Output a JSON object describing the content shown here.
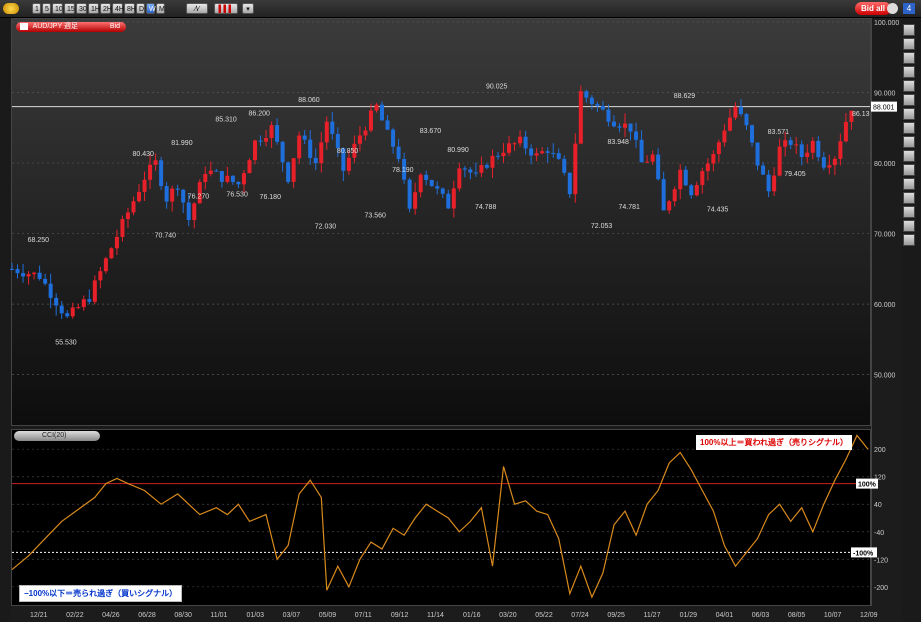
{
  "toolbar": {
    "timeframes": [
      "1",
      "5",
      "10",
      "15",
      "30",
      "1H",
      "2H",
      "4H",
      "8H",
      "D",
      "W",
      "M"
    ],
    "active_timeframe": "W",
    "bid_all_label": "Bid all"
  },
  "symbol": {
    "label": "AUD/JPY 週足",
    "side": "Bid"
  },
  "indicator": {
    "label": "CCI(20)"
  },
  "notes": {
    "overbought": "100%以上＝買われ過ぎ（売りシグナル）",
    "oversold": "−100%以下＝売られ過ぎ（買いシグナル）"
  },
  "cci_levels": {
    "plus": "100%",
    "minus": "-100%"
  },
  "colors": {
    "up": "#e8202a",
    "down": "#1e6fdc",
    "cci": "#d98a1c",
    "level100": "#cc2222",
    "levelm100": "#ffffff"
  },
  "chart_data": [
    {
      "type": "candlestick",
      "series": "AUD/JPY weekly (Bid)",
      "ylim": [
        43,
        100
      ],
      "yticks": [
        50,
        60,
        70,
        80,
        90,
        100
      ],
      "ytick_labels": [
        "50.000",
        "60.000",
        "70.000",
        "80.000",
        "90.000",
        "100.000"
      ],
      "current_price": 88.001,
      "current_price_label": "88.001",
      "last_visible_label": "86.13",
      "x_labels": [
        "12/21",
        "02/22",
        "04/26",
        "06/28",
        "08/30",
        "11/01",
        "01/03",
        "03/07",
        "05/09",
        "07/11",
        "09/12",
        "11/14",
        "01/16",
        "03/20",
        "05/22",
        "07/24",
        "09/25",
        "11/27",
        "01/29",
        "04/01",
        "06/03",
        "08/05",
        "10/07",
        "12/09"
      ],
      "price_path": [
        [
          0,
          65
        ],
        [
          5,
          64
        ],
        [
          10,
          58
        ],
        [
          14,
          61
        ],
        [
          18,
          68
        ],
        [
          21,
          73
        ],
        [
          24,
          78
        ],
        [
          26,
          80
        ],
        [
          28,
          75
        ],
        [
          30,
          77
        ],
        [
          32,
          72
        ],
        [
          35,
          79
        ],
        [
          38,
          78
        ],
        [
          41,
          77
        ],
        [
          44,
          83
        ],
        [
          47,
          85
        ],
        [
          50,
          78
        ],
        [
          52,
          84
        ],
        [
          55,
          80
        ],
        [
          57,
          86
        ],
        [
          60,
          79
        ],
        [
          63,
          84
        ],
        [
          66,
          88
        ],
        [
          68,
          84
        ],
        [
          70,
          81
        ],
        [
          72,
          73
        ],
        [
          74,
          79
        ],
        [
          76,
          77
        ],
        [
          79,
          74
        ],
        [
          81,
          80
        ],
        [
          84,
          78
        ],
        [
          86,
          80
        ],
        [
          89,
          82
        ],
        [
          92,
          83
        ],
        [
          95,
          81
        ],
        [
          97,
          82
        ],
        [
          99,
          80
        ],
        [
          101,
          76
        ],
        [
          103,
          90
        ],
        [
          106,
          88
        ],
        [
          109,
          86
        ],
        [
          112,
          85
        ],
        [
          114,
          80
        ],
        [
          116,
          81
        ],
        [
          118,
          73
        ],
        [
          121,
          79
        ],
        [
          123,
          76
        ],
        [
          125,
          79
        ],
        [
          127,
          81
        ],
        [
          129,
          85
        ],
        [
          131,
          88
        ],
        [
          133,
          85
        ],
        [
          135,
          80
        ],
        [
          137,
          76
        ],
        [
          139,
          82
        ],
        [
          141,
          83
        ],
        [
          143,
          81
        ],
        [
          145,
          83
        ],
        [
          147,
          80
        ],
        [
          149,
          81
        ],
        [
          151,
          86
        ],
        [
          152,
          88
        ]
      ],
      "annotations": [
        {
          "x": 5,
          "y": 68.25,
          "label": "68.250"
        },
        {
          "x": 10,
          "y": 55.53,
          "label": "55.530"
        },
        {
          "x": 24,
          "y": 80.43,
          "label": "80.430"
        },
        {
          "x": 28,
          "y": 70.74,
          "label": "70.740"
        },
        {
          "x": 31,
          "y": 81.99,
          "label": "81.990"
        },
        {
          "x": 34,
          "y": 76.27,
          "label": "76.270"
        },
        {
          "x": 39,
          "y": 85.31,
          "label": "85.310"
        },
        {
          "x": 41,
          "y": 76.53,
          "label": "76.530"
        },
        {
          "x": 45,
          "y": 86.2,
          "label": "86.200"
        },
        {
          "x": 47,
          "y": 76.18,
          "label": "76.180"
        },
        {
          "x": 54,
          "y": 88.06,
          "label": "88.060"
        },
        {
          "x": 57,
          "y": 72.03,
          "label": "72.030"
        },
        {
          "x": 61,
          "y": 80.85,
          "label": "80.850"
        },
        {
          "x": 66,
          "y": 73.56,
          "label": "73.560"
        },
        {
          "x": 71,
          "y": 78.19,
          "label": "78.190"
        },
        {
          "x": 76,
          "y": 83.67,
          "label": "83.670"
        },
        {
          "x": 81,
          "y": 80.99,
          "label": "80.990"
        },
        {
          "x": 86,
          "y": 74.788,
          "label": "74.788"
        },
        {
          "x": 88,
          "y": 90.025,
          "label": "90.025"
        },
        {
          "x": 107,
          "y": 72.053,
          "label": "72.053"
        },
        {
          "x": 110,
          "y": 83.948,
          "label": "83.948"
        },
        {
          "x": 112,
          "y": 74.781,
          "label": "74.781"
        },
        {
          "x": 122,
          "y": 88.629,
          "label": "88.629"
        },
        {
          "x": 128,
          "y": 74.435,
          "label": "74.435"
        },
        {
          "x": 139,
          "y": 83.571,
          "label": "83.571"
        },
        {
          "x": 142,
          "y": 79.405,
          "label": "79.405"
        }
      ]
    },
    {
      "type": "line",
      "series": "CCI(20)",
      "ylim": [
        -250,
        250
      ],
      "yticks": [
        200,
        120,
        40,
        -40,
        -120,
        -200
      ],
      "levels": [
        100,
        -100
      ],
      "points": [
        [
          0,
          -150
        ],
        [
          3,
          -110
        ],
        [
          6,
          -60
        ],
        [
          9,
          -10
        ],
        [
          12,
          25
        ],
        [
          15,
          60
        ],
        [
          17,
          100
        ],
        [
          19,
          115
        ],
        [
          21,
          100
        ],
        [
          24,
          80
        ],
        [
          27,
          40
        ],
        [
          30,
          70
        ],
        [
          32,
          40
        ],
        [
          34,
          10
        ],
        [
          37,
          30
        ],
        [
          39,
          10
        ],
        [
          41,
          40
        ],
        [
          43,
          -10
        ],
        [
          46,
          10
        ],
        [
          48,
          -120
        ],
        [
          50,
          -80
        ],
        [
          52,
          70
        ],
        [
          54,
          110
        ],
        [
          56,
          60
        ],
        [
          57,
          -210
        ],
        [
          59,
          -140
        ],
        [
          61,
          -200
        ],
        [
          63,
          -120
        ],
        [
          65,
          -70
        ],
        [
          67,
          -90
        ],
        [
          69,
          -30
        ],
        [
          71,
          -50
        ],
        [
          73,
          0
        ],
        [
          75,
          40
        ],
        [
          77,
          20
        ],
        [
          79,
          0
        ],
        [
          81,
          -40
        ],
        [
          83,
          -10
        ],
        [
          85,
          30
        ],
        [
          87,
          -140
        ],
        [
          89,
          150
        ],
        [
          91,
          40
        ],
        [
          93,
          50
        ],
        [
          95,
          20
        ],
        [
          97,
          10
        ],
        [
          99,
          -60
        ],
        [
          101,
          -220
        ],
        [
          103,
          -140
        ],
        [
          105,
          -230
        ],
        [
          107,
          -160
        ],
        [
          109,
          -20
        ],
        [
          111,
          20
        ],
        [
          113,
          -50
        ],
        [
          115,
          40
        ],
        [
          117,
          80
        ],
        [
          119,
          160
        ],
        [
          121,
          190
        ],
        [
          123,
          140
        ],
        [
          125,
          80
        ],
        [
          127,
          20
        ],
        [
          129,
          -80
        ],
        [
          131,
          -140
        ],
        [
          133,
          -100
        ],
        [
          135,
          -60
        ],
        [
          137,
          10
        ],
        [
          139,
          40
        ],
        [
          141,
          -10
        ],
        [
          143,
          30
        ],
        [
          145,
          -40
        ],
        [
          147,
          40
        ],
        [
          149,
          110
        ],
        [
          151,
          170
        ],
        [
          153,
          240
        ],
        [
          155,
          200
        ]
      ]
    }
  ]
}
